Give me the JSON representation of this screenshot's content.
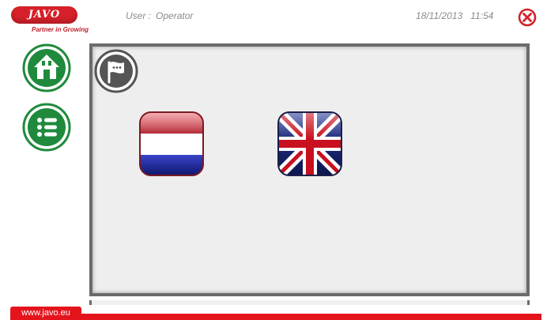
{
  "brand": {
    "logo_text": "JAVO",
    "tagline": "Partner in Growing",
    "website": "www.javo.eu",
    "color": "#e4141c"
  },
  "header": {
    "user_label": "User :",
    "user_name": "Operator",
    "date": "18/11/2013",
    "time": "11:54"
  },
  "nav": {
    "items": [
      {
        "name": "home",
        "icon": "home-icon"
      },
      {
        "name": "menu",
        "icon": "list-icon"
      }
    ],
    "accent": "#1f8a3c"
  },
  "main": {
    "section_icon": "language-flag-icon",
    "languages": [
      {
        "name": "Nederlands",
        "icon": "flag-netherlands"
      },
      {
        "name": "English",
        "icon": "flag-united-kingdom"
      }
    ]
  }
}
